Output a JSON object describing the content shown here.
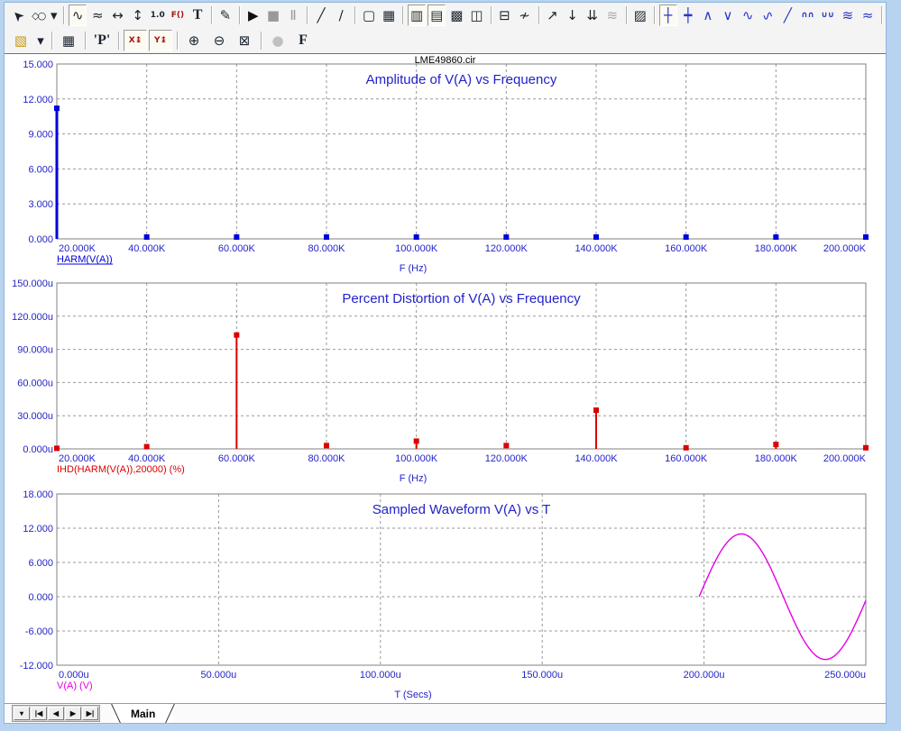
{
  "app": {
    "document_title": "LME49860.cir"
  },
  "colors": {
    "window_border": "#b7d3ef",
    "axis_text": "#2424c8",
    "chart_title": "#2222cc",
    "grid": "#999999",
    "frame": "#808080",
    "series_blue": "#0000de",
    "series_red": "#dd0000",
    "series_magenta": "#e600e6"
  },
  "toolbar_row1": [
    {
      "name": "select-cursor",
      "glyph": "➤",
      "cls": "rot"
    },
    {
      "name": "graphics-shapes",
      "glyph": "◇○",
      "cls": "tight"
    },
    {
      "name": "shapes-dropdown",
      "glyph": "▾",
      "narrow": true
    },
    {
      "sep": true
    },
    {
      "name": "scope-mode",
      "glyph": "∿",
      "pressed": true
    },
    {
      "name": "animate-mode",
      "glyph": "≈"
    },
    {
      "name": "horizontal-tag-mode",
      "glyph": "↔"
    },
    {
      "name": "vertical-tag-mode",
      "glyph": "↕"
    },
    {
      "name": "point-tag-mode",
      "glyph": "1.0",
      "cls": "small"
    },
    {
      "name": "function-tag-mode",
      "glyph": "F()",
      "cls": "small",
      "color": "#aa1010"
    },
    {
      "name": "text-mode",
      "glyph": "T",
      "cls": "serif"
    },
    {
      "sep": true
    },
    {
      "name": "properties",
      "glyph": "✎"
    },
    {
      "sep": true
    },
    {
      "name": "run",
      "glyph": "▶",
      "color": "#111111"
    },
    {
      "name": "stop",
      "glyph": "■",
      "color": "#9a9a9a"
    },
    {
      "name": "pause",
      "glyph": "Ⅱ",
      "color": "#9a9a9a"
    },
    {
      "sep": true
    },
    {
      "name": "line-mode",
      "glyph": "╱"
    },
    {
      "name": "polyline-mode",
      "glyph": "∕"
    },
    {
      "sep": true
    },
    {
      "name": "select-area",
      "glyph": "▢"
    },
    {
      "name": "grid-toggle",
      "glyph": "▦"
    },
    {
      "sep": true
    },
    {
      "name": "tile-vertical",
      "glyph": "▥",
      "pressed": true
    },
    {
      "name": "tile-horizontal",
      "glyph": "▤",
      "pressed": true
    },
    {
      "name": "overlap-panels",
      "glyph": "▩"
    },
    {
      "name": "column-panels",
      "glyph": "◫"
    },
    {
      "sep": true
    },
    {
      "name": "split-plot",
      "glyph": "⊟"
    },
    {
      "name": "exclude-curve",
      "glyph": "≁"
    },
    {
      "sep": true
    },
    {
      "name": "tag-vertical",
      "glyph": "↗"
    },
    {
      "name": "tag-point",
      "glyph": "↓"
    },
    {
      "name": "tag-both",
      "glyph": "⇊"
    },
    {
      "name": "align-curves",
      "glyph": "≋",
      "color": "#aaaaaa"
    },
    {
      "sep": true
    },
    {
      "name": "scope-thumbnail",
      "glyph": "▨"
    },
    {
      "sep": true
    },
    {
      "name": "cursor-crosshair",
      "glyph": "┼",
      "pressed": true,
      "color": "#2a35c8"
    },
    {
      "name": "cursor-horizontal",
      "glyph": "┿",
      "color": "#2a35c8"
    },
    {
      "name": "go-to-peak",
      "glyph": "∧",
      "color": "#2a35c8"
    },
    {
      "name": "go-to-valley",
      "glyph": "∨",
      "color": "#2a35c8"
    },
    {
      "name": "go-to-high",
      "glyph": "∿",
      "color": "#2a35c8"
    },
    {
      "name": "go-to-low",
      "glyph": "∿",
      "cls": "flip",
      "color": "#2a35c8"
    },
    {
      "name": "go-to-slope",
      "glyph": "╱",
      "color": "#2a35c8"
    },
    {
      "name": "go-to-inflection",
      "glyph": "∩∩",
      "cls": "small",
      "color": "#2a35c8"
    },
    {
      "name": "go-to-minimum",
      "glyph": "∪∪",
      "cls": "small",
      "color": "#2a35c8"
    },
    {
      "name": "go-to-envelope",
      "glyph": "≋",
      "color": "#2a35c8"
    },
    {
      "name": "go-to-center",
      "glyph": "≈",
      "color": "#2a35c8"
    },
    {
      "sep": true
    }
  ],
  "toolbar_row2": [
    {
      "name": "analysis-limits",
      "glyph": "▧",
      "color": "#c49a12"
    },
    {
      "name": "limits-dropdown",
      "glyph": "▾",
      "narrow": true
    },
    {
      "sep": true
    },
    {
      "name": "numeric-output",
      "glyph": "▦"
    },
    {
      "sep": true
    },
    {
      "name": "periodic-steady-state",
      "glyph": "'P'",
      "cls": "serif"
    },
    {
      "sep": true
    },
    {
      "name": "auto-scale-x",
      "glyph": "X↨",
      "cls": "small",
      "pressed": true,
      "color": "#aa1010"
    },
    {
      "name": "auto-scale-y",
      "glyph": "Y↨",
      "cls": "small",
      "pressed": true,
      "color": "#aa1010"
    },
    {
      "sep": true
    },
    {
      "name": "zoom-in",
      "glyph": "⊕"
    },
    {
      "name": "zoom-out",
      "glyph": "⊖"
    },
    {
      "name": "zoom-area",
      "glyph": "⊠"
    },
    {
      "sep": true
    },
    {
      "name": "web-help",
      "glyph": "●",
      "color": "#c0c0c0"
    },
    {
      "name": "font-tool",
      "glyph": "F",
      "cls": "serif"
    }
  ],
  "bottom_bar": {
    "tab_label": "Main",
    "nav_buttons": [
      {
        "name": "tab-list-dropdown",
        "glyph": "▾"
      },
      {
        "name": "first-tab",
        "glyph": "|◀"
      },
      {
        "name": "prev-tab",
        "glyph": "◀"
      },
      {
        "name": "next-tab",
        "glyph": "▶"
      },
      {
        "name": "last-tab",
        "glyph": "▶|"
      }
    ]
  },
  "chart_data": [
    {
      "type": "bar",
      "title": "Amplitude of V(A) vs Frequency",
      "series_label": "HARM(V(A))",
      "series_label_underline": true,
      "xlabel": "F (Hz)",
      "x_khz": [
        20,
        40,
        60,
        80,
        100,
        120,
        140,
        160,
        180,
        200
      ],
      "x_ticks": [
        "20.000K",
        "40.000K",
        "60.000K",
        "80.000K",
        "100.000K",
        "120.000K",
        "140.000K",
        "160.000K",
        "180.000K",
        "200.000K"
      ],
      "y_ticks": [
        "15.000",
        "12.000",
        "9.000",
        "6.000",
        "3.000",
        "0.000"
      ],
      "ylim": [
        0,
        15
      ],
      "values": [
        11.2,
        0,
        0,
        0,
        0,
        0,
        0,
        0,
        0,
        0
      ],
      "color": "#0000de"
    },
    {
      "type": "bar",
      "title": "Percent Distortion of V(A) vs Frequency",
      "series_label": "IHD(HARM(V(A)),20000) (%)",
      "series_label_underline": false,
      "xlabel": "F (Hz)",
      "x_khz": [
        20,
        40,
        60,
        80,
        100,
        120,
        140,
        160,
        180,
        200
      ],
      "x_ticks": [
        "20.000K",
        "40.000K",
        "60.000K",
        "80.000K",
        "100.000K",
        "120.000K",
        "140.000K",
        "160.000K",
        "180.000K",
        "200.000K"
      ],
      "y_ticks": [
        "150.000u",
        "120.000u",
        "90.000u",
        "60.000u",
        "30.000u",
        "0.000u"
      ],
      "ylim": [
        0,
        150
      ],
      "values": [
        0.5,
        2,
        103,
        3,
        7,
        3,
        35,
        1,
        4,
        1
      ],
      "color": "#dd0000"
    },
    {
      "type": "line",
      "title": "Sampled Waveform  V(A) vs T",
      "series_label": "V(A) (V)",
      "series_label_underline": false,
      "xlabel": "T (Secs)",
      "x_ticks": [
        "0.000u",
        "50.000u",
        "100.000u",
        "150.000u",
        "200.000u",
        "250.000u"
      ],
      "y_ticks": [
        "18.000",
        "12.000",
        "6.000",
        "0.000",
        "-6.000",
        "-12.000"
      ],
      "ylim": [
        -12,
        18
      ],
      "xlim_u": [
        0,
        250
      ],
      "waveform": {
        "shape": "sine",
        "amplitude": 11,
        "start_u": 198.5,
        "end_u": 250,
        "period_u": 52
      },
      "color": "#e600e6"
    }
  ]
}
